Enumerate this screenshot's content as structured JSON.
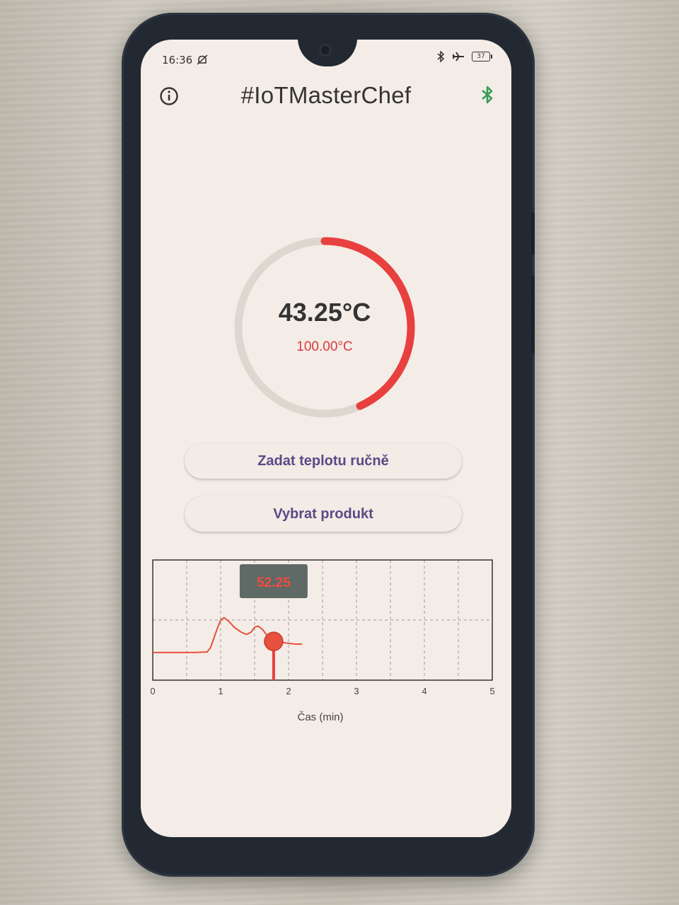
{
  "status_bar": {
    "time": "16:36",
    "battery": "37"
  },
  "app_bar": {
    "title": "#IoTMasterChef"
  },
  "gauge": {
    "current": "43.25°C",
    "target": "100.00°C",
    "progress": 0.4325
  },
  "buttons": {
    "manual_temp": "Zadat teplotu ručně",
    "select_product": "Vybrat produkt"
  },
  "colors": {
    "accent_red": "#e8403f",
    "track": "#dcd7cf",
    "button_text": "#5a4a85",
    "bluetooth": "#3c9a5a"
  },
  "chart_data": {
    "type": "line",
    "xlabel": "Čas (min)",
    "x_ticks": [
      "0",
      "1",
      "2",
      "3",
      "4",
      "5"
    ],
    "xlim": [
      0,
      5
    ],
    "ylim": [
      20,
      120
    ],
    "series": [
      {
        "values": [
          [
            0,
            43
          ],
          [
            0.3,
            43
          ],
          [
            0.6,
            43
          ],
          [
            0.8,
            43.5
          ],
          [
            0.85,
            47
          ],
          [
            0.9,
            55
          ],
          [
            0.95,
            63
          ],
          [
            1.0,
            70
          ],
          [
            1.05,
            72
          ],
          [
            1.12,
            69
          ],
          [
            1.2,
            64
          ],
          [
            1.3,
            60
          ],
          [
            1.38,
            58
          ],
          [
            1.45,
            60
          ],
          [
            1.5,
            64
          ],
          [
            1.55,
            65
          ],
          [
            1.62,
            62
          ],
          [
            1.7,
            56
          ],
          [
            1.78,
            52.25
          ],
          [
            1.85,
            52
          ],
          [
            1.95,
            51
          ],
          [
            2.1,
            50
          ],
          [
            2.2,
            50
          ]
        ]
      }
    ],
    "tooltip": {
      "x": 1.78,
      "label": "52.25"
    }
  }
}
